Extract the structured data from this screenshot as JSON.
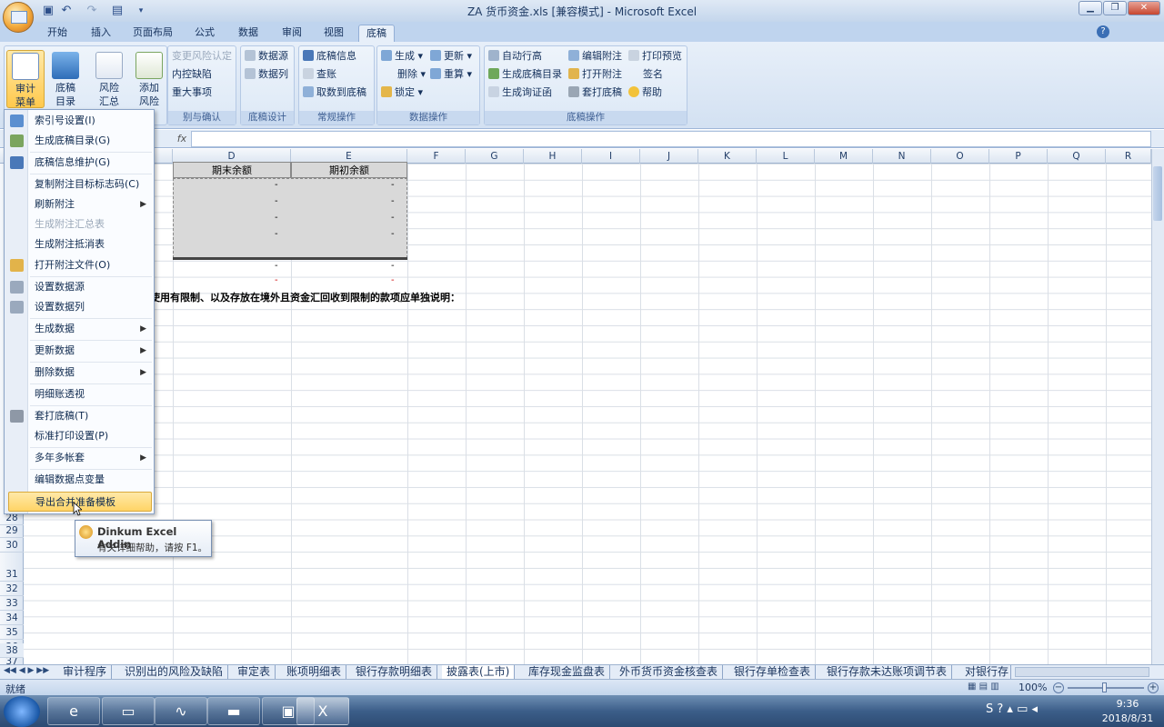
{
  "window": {
    "title": "ZA 货币资金.xls  [兼容模式] - Microsoft Excel"
  },
  "tabs": [
    "开始",
    "插入",
    "页面布局",
    "公式",
    "数据",
    "审阅",
    "视图",
    "底稿"
  ],
  "ribbon": {
    "big_buttons": [
      {
        "l1": "审计",
        "l2": "菜单"
      },
      {
        "l1": "底稿",
        "l2": "目录"
      },
      {
        "l1": "风险",
        "l2": "汇总"
      },
      {
        "l1": "添加",
        "l2": "风险"
      }
    ],
    "group1": {
      "items": [
        "变更风险认定",
        "内控缺陷",
        "重大事项"
      ],
      "label": "别与确认"
    },
    "group2": {
      "items": [
        "数据源",
        "数据列"
      ],
      "label": "底稿设计"
    },
    "group3": {
      "items": [
        "底稿信息",
        "查账",
        "取数到底稿"
      ],
      "label": "常规操作"
    },
    "group4": {
      "col1": [
        "生成",
        "删除",
        "锁定"
      ],
      "col2": [
        "更新",
        "重算"
      ],
      "label": "数据操作"
    },
    "group5": {
      "col1": [
        "自动行高",
        "生成底稿目录",
        "生成询证函"
      ],
      "col2": [
        "编辑附注",
        "打开附注",
        "套打底稿"
      ],
      "col3": [
        "打印预览",
        "签名",
        "帮助"
      ],
      "label": "底稿操作"
    }
  },
  "formula_bar": {
    "fx": "fx",
    "value": ""
  },
  "columns": [
    "D",
    "E",
    "F",
    "G",
    "H",
    "I",
    "J",
    "K",
    "L",
    "M",
    "N",
    "O",
    "P",
    "Q",
    "R"
  ],
  "rows": [
    "28",
    "29",
    "30",
    "31",
    "32",
    "33",
    "34",
    "35",
    "36",
    "37",
    "38"
  ],
  "sheet": {
    "header_d": "期末余额",
    "header_e": "期初余额",
    "dash": "-",
    "note": "使用有限制、以及存放在境外且资金汇回收到限制的款项应单独说明："
  },
  "menu": {
    "items": [
      {
        "label": "索引号设置(I)"
      },
      {
        "label": "生成底稿目录(G)"
      },
      {
        "label": "底稿信息维护(G)"
      },
      {
        "label": "复制附注目标标志码(C)"
      },
      {
        "label": "刷新附注",
        "submenu": true
      },
      {
        "label": "生成附注汇总表",
        "disabled": true
      },
      {
        "label": "生成附注抵消表"
      },
      {
        "label": "打开附注文件(O)"
      },
      {
        "label": "设置数据源"
      },
      {
        "label": "设置数据列"
      },
      {
        "label": "生成数据",
        "submenu": true
      },
      {
        "label": "更新数据",
        "submenu": true
      },
      {
        "label": "删除数据",
        "submenu": true
      },
      {
        "label": "明细账透视"
      },
      {
        "label": "套打底稿(T)"
      },
      {
        "label": "标准打印设置(P)"
      },
      {
        "label": "多年多帐套",
        "submenu": true
      },
      {
        "label": "编辑数据点变量"
      },
      {
        "label": "导出合并准备模板",
        "highlight": true
      }
    ]
  },
  "tooltip": {
    "title": "Dinkum Excel Addin",
    "body": "有关详细帮助，请按 F1。"
  },
  "sheet_tabs": [
    "审计程序",
    "识别出的风险及缺陷",
    "审定表",
    "账项明细表",
    "银行存款明细表",
    "披露表(上市)",
    "库存现金监盘表",
    "外币货币资金核查表",
    "银行存单检查表",
    "银行存款未达账项调节表",
    "对银行存"
  ],
  "active_sheet_tab": 5,
  "status": {
    "mode": "就绪",
    "zoom": "100%"
  },
  "taskbar": {
    "time": "9:36",
    "date": "2018/8/31"
  }
}
